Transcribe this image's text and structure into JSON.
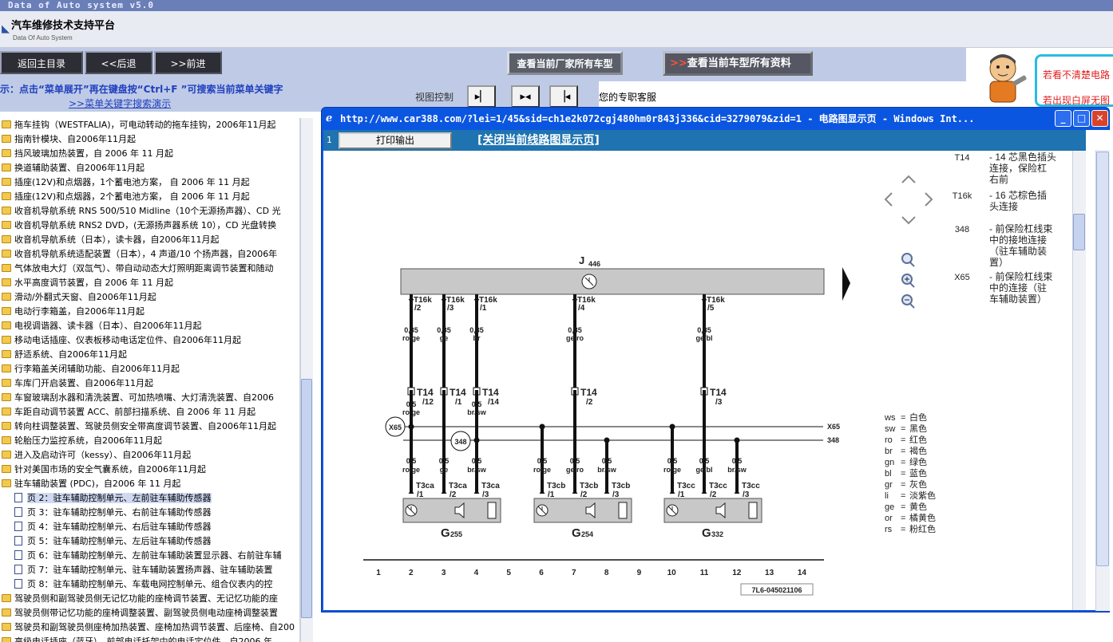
{
  "window": {
    "title": "Data of Auto system v5.0"
  },
  "brand": {
    "title": "汽车维修技术支持平台",
    "subtitle": "Data Of Auto System"
  },
  "nav": {
    "main_menu": "返回主目录",
    "back": "<<后退",
    "forward": ">>前进",
    "all_models": "查看当前厂家所有车型",
    "all_data": "查看当前车型所有资料",
    "all_data_prefix": ">>"
  },
  "tip": {
    "text": "示：点击“菜单展开”再在键盘按“Ctrl+F ”可搜索当前菜单关键字",
    "link": ">>菜单关键字搜索演示"
  },
  "view_control": {
    "label": "视图控制"
  },
  "support": {
    "text": "您的专职客服"
  },
  "right_banner": {
    "line1": "若看不清楚电路",
    "line2": "若出现白屏无图"
  },
  "tree": {
    "items": [
      {
        "label": "拖车挂钩（WESTFALIA)，可电动转动的拖车挂钩，2006年11月起",
        "type": "folder"
      },
      {
        "label": "指南针模块、自2006年11月起",
        "type": "folder"
      },
      {
        "label": "挡风玻璃加热装置，自 2006 年 11 月起",
        "type": "folder"
      },
      {
        "label": "换道辅助装置、自2006年11月起",
        "type": "folder"
      },
      {
        "label": "插座(12V)和点烟器，1个蓄电池方案， 自 2006 年 11 月起",
        "type": "folder"
      },
      {
        "label": "插座(12V)和点烟器，2个蓄电池方案， 自 2006 年 11 月起",
        "type": "folder"
      },
      {
        "label": "收音机导航系统 RNS 500/510 Midline（10个无源扬声器）、CD 光",
        "type": "folder"
      },
      {
        "label": "收音机导航系统 RNS2 DVD，(无源扬声器系统 10），CD 光盘转换",
        "type": "folder"
      },
      {
        "label": "收音机导航系统（日本），读卡器，自2006年11月起",
        "type": "folder"
      },
      {
        "label": "收音机导航系统适配装置（日本），4 声道/10 个扬声器，自2006年",
        "type": "folder"
      },
      {
        "label": "气体放电大灯（双氙气）、带自动动态大灯照明距离调节装置和随动",
        "type": "folder"
      },
      {
        "label": "水平高度调节装置，自 2006 年 11 月起",
        "type": "folder"
      },
      {
        "label": "滑动/外翻式天窗、自2006年11月起",
        "type": "folder"
      },
      {
        "label": "电动行李箱盖，自2006年11月起",
        "type": "folder"
      },
      {
        "label": "电视调谐器、读卡器（日本）、自2006年11月起",
        "type": "folder"
      },
      {
        "label": "移动电话插座、仪表板移动电话定位件、自2006年11月起",
        "type": "folder"
      },
      {
        "label": "舒适系统、自2006年11月起",
        "type": "folder"
      },
      {
        "label": "行李箱盖关闭辅助功能、自2006年11月起",
        "type": "folder"
      },
      {
        "label": "车库门开启装置、自2006年11月起",
        "type": "folder"
      },
      {
        "label": "车窗玻璃刮水器和清洗装置、可加热喷嘴、大灯清洗装置、自2006",
        "type": "folder"
      },
      {
        "label": "车距自动调节装置 ACC、前部扫描系统、自 2006 年 11 月起",
        "type": "folder"
      },
      {
        "label": "转向柱调整装置、驾驶员侧安全带高度调节装置、自2006年11月起",
        "type": "folder"
      },
      {
        "label": "轮胎压力监控系统，自2006年11月起",
        "type": "folder"
      },
      {
        "label": "进入及启动许可（kessy）、自2006年11月起",
        "type": "folder"
      },
      {
        "label": "针对美国市场的安全气囊系统，自2006年11月起",
        "type": "folder"
      },
      {
        "label": "驻车辅助装置 (PDC)，自2006 年 11 月起",
        "type": "folder"
      },
      {
        "label": "页 2：驻车辅助控制单元、左前驻车辅助传感器",
        "type": "page",
        "selected": true
      },
      {
        "label": "页 3：驻车辅助控制单元、右前驻车辅助传感器",
        "type": "page"
      },
      {
        "label": "页 4：驻车辅助控制单元、右后驻车辅助传感器",
        "type": "page"
      },
      {
        "label": "页 5：驻车辅助控制单元、左后驻车辅助传感器",
        "type": "page"
      },
      {
        "label": "页 6：驻车辅助控制单元、左前驻车辅助装置显示器、右前驻车辅",
        "type": "page"
      },
      {
        "label": "页 7：驻车辅助控制单元、驻车辅助装置扬声器、驻车辅助装置",
        "type": "page"
      },
      {
        "label": "页 8：驻车辅助控制单元、车载电网控制单元、组合仪表内的控",
        "type": "page"
      },
      {
        "label": "驾驶员侧和副驾驶员侧无记忆功能的座椅调节装置、无记忆功能的座",
        "type": "folder"
      },
      {
        "label": "驾驶员侧带记忆功能的座椅调整装置、副驾驶员侧电动座椅调整装置",
        "type": "folder"
      },
      {
        "label": "驾驶员和副驾驶员侧座椅加热装置、座椅加热调节装置、后座椅、自200",
        "type": "folder"
      },
      {
        "label": "高级电话插座（蓝牙）、前部电话托架中的电话定位件，自2006 年",
        "type": "folder"
      }
    ]
  },
  "popup": {
    "title": "http://www.car388.com/?lei=1/45&sid=ch1e2k072cgj480hm0r843j336&cid=3279079&zid=1 - 电路图显示页 - Windows Int...",
    "page_num": "1",
    "print_label": "打印输出",
    "close_label": "[关闭当前线路图显示页]"
  },
  "diagram": {
    "j446": "J",
    "j446_sub": "446",
    "code": "7L6-045021106",
    "legend_right": [
      {
        "code": "T14",
        "desc": [
          "- 14 芯黑色插头",
          "连接，保险杠",
          "右前"
        ]
      },
      {
        "code": "T16k",
        "desc": [
          "- 16 芯棕色插",
          "头连接"
        ]
      },
      {
        "code": "348",
        "desc": [
          "- 前保险杠线束",
          "中的接地连接",
          "（驻车辅助装",
          "置）"
        ]
      },
      {
        "code": "X65",
        "desc": [
          "- 前保险杠线束",
          "中的连接（驻",
          "车辅助装置）"
        ]
      }
    ],
    "colors": [
      {
        "code": "ws",
        "name": "白色"
      },
      {
        "code": "sw",
        "name": "黑色"
      },
      {
        "code": "ro",
        "name": "红色"
      },
      {
        "code": "br",
        "name": "褐色"
      },
      {
        "code": "gn",
        "name": "绿色"
      },
      {
        "code": "bl",
        "name": "蓝色"
      },
      {
        "code": "gr",
        "name": "灰色"
      },
      {
        "code": "li",
        "name": "淡紫色"
      },
      {
        "code": "ge",
        "name": "黄色"
      },
      {
        "code": "or",
        "name": "橘黄色"
      },
      {
        "code": "rs",
        "name": "粉红色"
      }
    ],
    "top_wires": [
      {
        "conn": "T16k",
        "pin": "/2",
        "size": "0,35",
        "color": "ro/ge"
      },
      {
        "conn": "T16k",
        "pin": "/3",
        "size": "0,35",
        "color": "ge"
      },
      {
        "conn": "T16k",
        "pin": "/1",
        "size": "0,35",
        "color": "br"
      },
      {
        "conn": "T16k",
        "pin": "/4",
        "size": "0,35",
        "color": "ge/ro"
      },
      {
        "conn": "T16k",
        "pin": "/5",
        "size": "0,35",
        "color": "ge/bl"
      }
    ],
    "t14_pins": [
      "/12",
      "/1",
      "/14",
      "/2",
      "/3"
    ],
    "t14_label": "T14",
    "mid_wires": [
      {
        "size": "0,5",
        "color": "ro/ge"
      },
      {
        "size": "0,5",
        "color": "br/sw"
      }
    ],
    "x65": "X65",
    "n348": "348",
    "bottom_wires": [
      {
        "size": "0,5",
        "color": "ro/ge"
      },
      {
        "size": "0,5",
        "color": "ge"
      },
      {
        "size": "0,5",
        "color": "br/sw"
      },
      {
        "size": "0,5",
        "color": "ro/ge"
      },
      {
        "size": "0,5",
        "color": "ge/ro"
      },
      {
        "size": "0,5",
        "color": "br/sw"
      },
      {
        "size": "0,5",
        "color": "ro/ge"
      },
      {
        "size": "0,5",
        "color": "ge/bl"
      },
      {
        "size": "0,5",
        "color": "br/sw"
      }
    ],
    "bottom_conns": [
      {
        "conn": "T3ca",
        "pin": "/1"
      },
      {
        "conn": "T3ca",
        "pin": "/2"
      },
      {
        "conn": "T3ca",
        "pin": "/3"
      },
      {
        "conn": "T3cb",
        "pin": "/1"
      },
      {
        "conn": "T3cb",
        "pin": "/2"
      },
      {
        "conn": "T3cb",
        "pin": "/3"
      },
      {
        "conn": "T3cc",
        "pin": "/1"
      },
      {
        "conn": "T3cc",
        "pin": "/2"
      },
      {
        "conn": "T3cc",
        "pin": "/3"
      }
    ],
    "sensors": [
      {
        "label": "G",
        "sub": "255"
      },
      {
        "label": "G",
        "sub": "254"
      },
      {
        "label": "G",
        "sub": "332"
      }
    ],
    "columns": [
      "1",
      "2",
      "3",
      "4",
      "5",
      "6",
      "7",
      "8",
      "9",
      "10",
      "11",
      "12",
      "13",
      "14"
    ]
  }
}
